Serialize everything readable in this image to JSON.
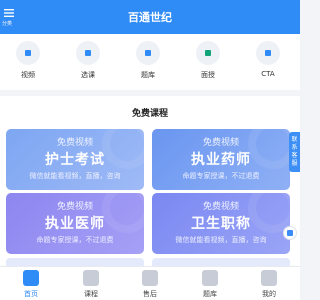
{
  "header": {
    "title": "百通世纪",
    "menu_label": "分类"
  },
  "nav": [
    {
      "label": "视频",
      "icon": "video-icon",
      "color": "#2f8bf5"
    },
    {
      "label": "选课",
      "icon": "course-icon",
      "color": "#2f8bf5"
    },
    {
      "label": "题库",
      "icon": "question-bank-icon",
      "color": "#2f8bf5"
    },
    {
      "label": "面授",
      "icon": "classroom-icon",
      "color": "#13a37a"
    },
    {
      "label": "CTA",
      "icon": "cta-icon",
      "color": "#2f8bf5"
    }
  ],
  "section": {
    "title": "免费课程"
  },
  "cards": [
    {
      "top": "免费视频",
      "main": "护士考试",
      "sub": "微信就能看视频，直播，咨询"
    },
    {
      "top": "免费视频",
      "main": "执业药师",
      "sub": "命题专家授课，不过退费"
    },
    {
      "top": "免费视频",
      "main": "执业医师",
      "sub": "命题专家授课，不过退费"
    },
    {
      "top": "免费视频",
      "main": "卫生职称",
      "sub": "微信就能看视频，直播，咨询"
    }
  ],
  "side_tab": "联系客服",
  "tabs": [
    {
      "label": "首页",
      "icon": "home-icon",
      "active": true
    },
    {
      "label": "课程",
      "icon": "play-icon",
      "active": false
    },
    {
      "label": "售后",
      "icon": "flame-icon",
      "active": false
    },
    {
      "label": "题库",
      "icon": "list-icon",
      "active": false
    },
    {
      "label": "我的",
      "icon": "user-icon",
      "active": false
    }
  ],
  "colors": {
    "brand": "#2f8bf5",
    "accent_green": "#13a37a"
  }
}
